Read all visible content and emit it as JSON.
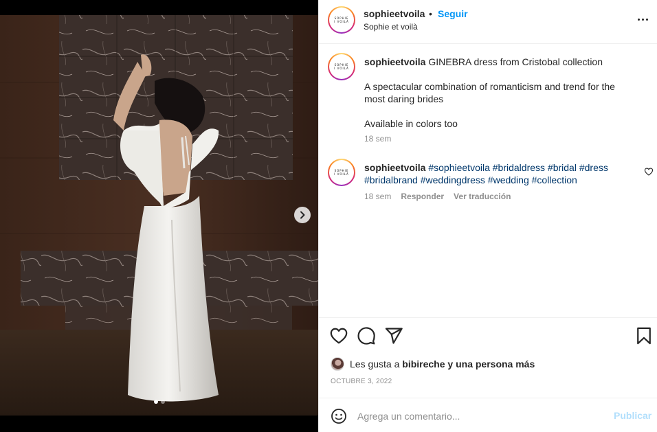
{
  "post": {
    "username": "sophieetvoila",
    "bullet": "•",
    "follow_label": "Seguir",
    "subtitle": "Sophie et voilà",
    "avatar_logo": [
      "SOPHIE",
      "I VOILÀ"
    ],
    "more_icon": "more-horizontal-icon",
    "carousel": {
      "current": 1,
      "total": 2
    }
  },
  "caption": {
    "username": "sophieetvoila",
    "line1": "GINEBRA dress from Cristobal collection",
    "line2": "A spectacular combination of romanticism and trend for the most daring brides",
    "line3": "Available in colors too",
    "time": "18 sem"
  },
  "comment": {
    "username": "sophieetvoila",
    "hashtags": [
      "#sophieetvoila",
      "#bridaldress",
      "#bridal",
      "#dress",
      "#bridalbrand",
      "#weddingdress",
      "#wedding",
      "#collection"
    ],
    "time": "18 sem",
    "reply_label": "Responder",
    "translate_label": "Ver traducción"
  },
  "likes": {
    "prefix": "Les gusta a",
    "user": "bibireche",
    "connector": "y",
    "others": "y una persona más"
  },
  "date": "OCTUBRE 3, 2022",
  "composer": {
    "placeholder": "Agrega un comentario...",
    "publish_label": "Publicar"
  },
  "colors": {
    "follow": "#0095f6",
    "hashtag": "#00376b",
    "muted": "#8e8e8e",
    "publish_disabled": "#b2dffc"
  }
}
